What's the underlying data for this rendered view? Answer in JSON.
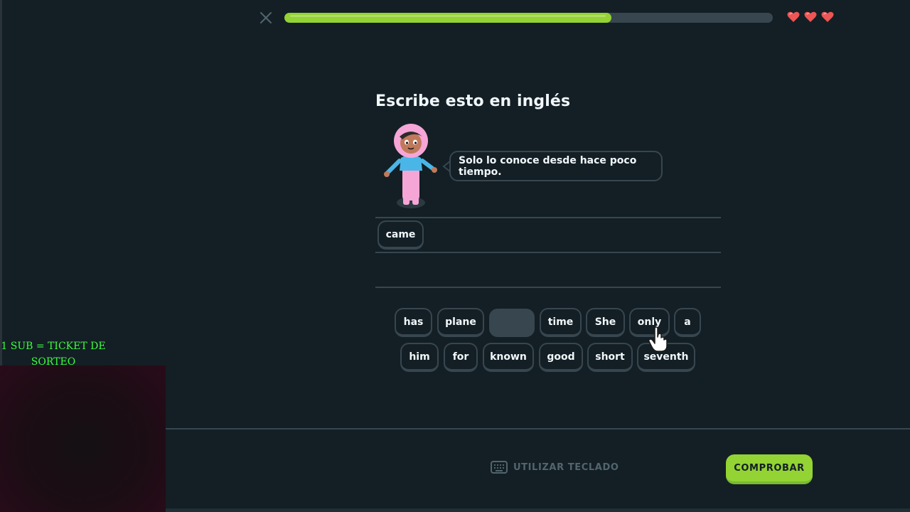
{
  "header": {
    "close_icon": "close-icon",
    "progress": 0.67,
    "lives": 3,
    "heart_icon": "heart-icon",
    "colors": {
      "progress": "#93d333",
      "track": "#37464f",
      "heart": "#ee5555"
    }
  },
  "challenge": {
    "title": "Escribe esto en inglés",
    "prompt": "Solo lo conoce desde hace poco tiempo."
  },
  "answer": {
    "tiles": [
      "came"
    ]
  },
  "word_bank": {
    "row1": [
      "has",
      "plane",
      "",
      "time",
      "She",
      "only",
      "a"
    ],
    "row2": [
      "him",
      "for",
      "known",
      "good",
      "short",
      "seventh"
    ]
  },
  "overlay": {
    "promo_line1": "1 SUB = TICKET DE",
    "promo_line2": "SORTEO"
  },
  "footer": {
    "keyboard_label": "UTILIZAR TECLADO",
    "keyboard_icon": "keyboard-icon",
    "check_label": "COMPROBAR",
    "colors": {
      "check": "#93d333"
    }
  }
}
